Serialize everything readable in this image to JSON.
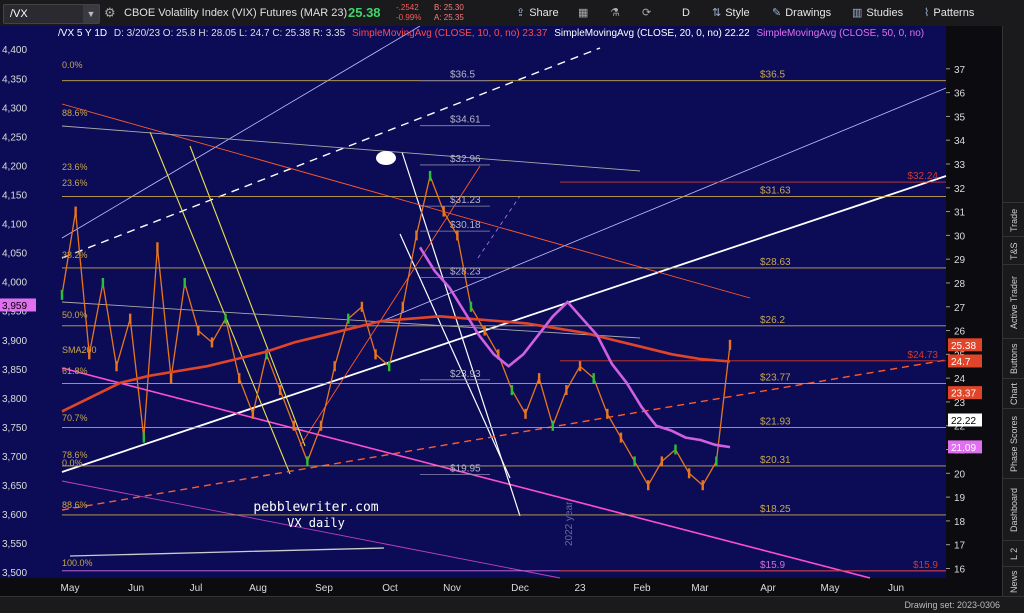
{
  "toolbar": {
    "symbol": "/VX",
    "title": "CBOE Volatility Index (VIX) Futures (MAR 23)",
    "price": "25.38",
    "change_top": "-.2542",
    "change_pct": "-0.99%",
    "bid": "B: 25.30",
    "ask": "A: 25.35",
    "share": "Share",
    "period": "D",
    "style": "Style",
    "drawings": "Drawings",
    "studies": "Studies",
    "patterns": "Patterns"
  },
  "infoline": {
    "sym": "/VX 5 Y 1D",
    "ohlc": "D: 3/20/23  O: 25.8  H: 28.05  L: 24.7  C: 25.38  R: 3.35",
    "sma10": "SimpleMovingAvg (CLOSE, 10, 0, no)",
    "sma10_val": "23.37",
    "sma20": "SimpleMovingAvg (CLOSE, 20, 0, no)",
    "sma20_val": "22.22",
    "sma_pink": "SimpleMovingAvg (CLOSE, 50, 0, no)"
  },
  "sidebar": [
    "News",
    "L 2",
    "Dashboard",
    "Phase Scores",
    "Chart",
    "Buttons",
    "Active Trader",
    "T&S",
    "Trade"
  ],
  "status": {
    "drawing_set": "Drawing set: 2023-0306"
  },
  "watermark": {
    "line1": "pebblewriter.com",
    "line2": "VX daily",
    "year": "2022 year"
  },
  "chart_data": {
    "type": "line",
    "title": "CBOE Volatility Index (VIX) Futures (MAR 23)",
    "x_tick_labels": [
      "May",
      "Jun",
      "Jul",
      "Aug",
      "Sep",
      "Oct",
      "Nov",
      "Dec",
      "23",
      "Feb",
      "Mar",
      "Apr",
      "May",
      "Jun"
    ],
    "left_axis": {
      "label": "",
      "ylim": [
        3490,
        4440
      ],
      "ticks": [
        3500,
        3550,
        3600,
        3650,
        3700,
        3750,
        3800,
        3850,
        3900,
        3950,
        4000,
        4050,
        4100,
        4150,
        4200,
        4250,
        4300,
        4350,
        4400
      ],
      "tick_labels": [
        "3,500",
        "3,550",
        "3,600",
        "3,650",
        "3,700",
        "3,750",
        "3,800",
        "3,850",
        "3,900",
        "3,950",
        "4,000",
        "4,050",
        "4,100",
        "4,150",
        "4,200",
        "4,250",
        "4,300",
        "4,350",
        "4,400"
      ],
      "highlight": "3,959"
    },
    "right_axis": {
      "label": "",
      "ylim": [
        15.6,
        38.8
      ],
      "ticks": [
        16,
        17,
        18,
        19,
        20,
        21,
        22,
        23,
        24,
        25,
        26,
        27,
        28,
        29,
        30,
        31,
        32,
        33,
        34,
        35,
        36,
        37
      ],
      "badges": [
        {
          "value": 25.38,
          "label": "25.38",
          "color": "#e0452a"
        },
        {
          "value": 24.7,
          "label": "24.7",
          "color": "#e0452a"
        },
        {
          "value": 23.37,
          "label": "23.37",
          "color": "#e0452a"
        },
        {
          "value": 22.22,
          "label": "22.22",
          "color": "#ffffff"
        },
        {
          "value": 21.09,
          "label": "21.09",
          "color": "#e070f0"
        }
      ]
    },
    "horizontal_levels": [
      {
        "value": 36.5,
        "label": "$36.5",
        "color": "#c8a84a"
      },
      {
        "value": 31.63,
        "label": "$31.63",
        "color": "#c8a84a"
      },
      {
        "value": 28.63,
        "label": "$28.63",
        "color": "#c8a84a"
      },
      {
        "value": 26.2,
        "label": "$26.2",
        "color": "#c8a84a"
      },
      {
        "value": 23.77,
        "label": "$23.77",
        "color": "#c8a84a"
      },
      {
        "value": 21.93,
        "label": "$21.93",
        "color": "#c8a84a"
      },
      {
        "value": 20.31,
        "label": "$20.31",
        "color": "#c8a84a"
      },
      {
        "value": 18.25,
        "label": "$18.25",
        "color": "#c8a84a"
      },
      {
        "value": 32.24,
        "label": "$32.24",
        "color": "#d03a2a"
      },
      {
        "value": 24.73,
        "label": "$24.73",
        "color": "#d03a2a"
      },
      {
        "value": 15.9,
        "label": "$15.9",
        "color": "#d070e0"
      },
      {
        "value": 15.9,
        "label": "$15.9",
        "color": "#d03a2a"
      }
    ],
    "grey_levels": [
      {
        "value": 36.5,
        "label": "$36.5"
      },
      {
        "value": 34.61,
        "label": "$34.61"
      },
      {
        "value": 32.96,
        "label": "$32.96"
      },
      {
        "value": 31.23,
        "label": "$31.23"
      },
      {
        "value": 30.18,
        "label": "$30.18"
      },
      {
        "value": 28.23,
        "label": "$28.23"
      },
      {
        "value": 23.93,
        "label": "$23.93"
      },
      {
        "value": 19.95,
        "label": "$19.95"
      }
    ],
    "fib_labels": [
      "0.0%",
      "88.6%",
      "23.6%",
      "23.6%",
      "38.2%",
      "50.0%",
      "61.8%",
      "70.7%",
      "78.6%",
      "0.0%",
      "88.6%",
      "100.0%",
      "SMA200"
    ],
    "series": [
      {
        "name": "/VX",
        "color": "#e8761e",
        "values": [
          27.5,
          31,
          25,
          28,
          24.5,
          26.5,
          21.5,
          29.5,
          24,
          28,
          26,
          25.5,
          26.5,
          24,
          22.5,
          25,
          23.5,
          22,
          20.5,
          22,
          24.5,
          26.5,
          27,
          25,
          24.5,
          27,
          30,
          32.5,
          31,
          30,
          27,
          26,
          25,
          23.5,
          22.5,
          24,
          22,
          23.5,
          24.5,
          24,
          22.5,
          21.5,
          20.5,
          19.5,
          20.5,
          21,
          20,
          19.5,
          20.5,
          25.4
        ]
      },
      {
        "name": "SMA200",
        "color": "#e0452a",
        "values": [
          22.6,
          23.2,
          23.8,
          24.1,
          24.3,
          24.5,
          24.8,
          25.1,
          25.5,
          25.8,
          26.1,
          26.4,
          26.5,
          26.6,
          26.5,
          26.4,
          26.3,
          26.1,
          25.9,
          25.6,
          25.3,
          25.0,
          24.8,
          24.7
        ]
      },
      {
        "name": "SMA50",
        "color": "#d060e0",
        "values": [
          29.5,
          28.5,
          27.8,
          26.8,
          25.8,
          25.0,
          24.5,
          25.0,
          25.8,
          26.6,
          27.2,
          26.5,
          25.8,
          24.6,
          23.8,
          22.8,
          22.0,
          21.8,
          21.5,
          21.4,
          21.2,
          21.1
        ]
      }
    ]
  }
}
